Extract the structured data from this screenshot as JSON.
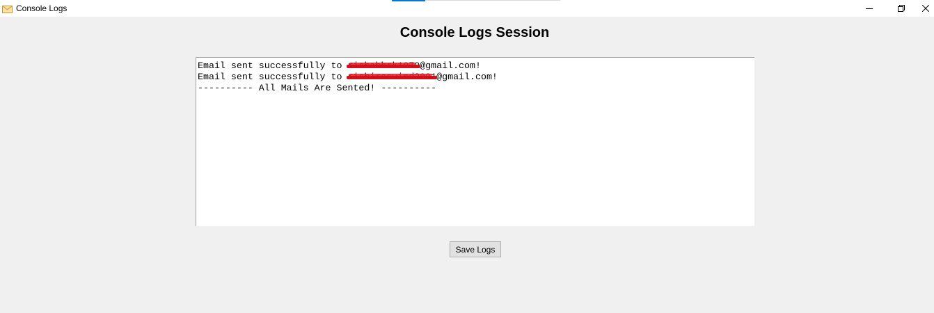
{
  "window": {
    "title": "Console Logs",
    "app_icon": "envelope-icon",
    "controls": {
      "minimize_icon": "minimize-icon",
      "maximize_icon": "restore-icon",
      "close_icon": "close-icon"
    }
  },
  "heading": "Console Logs Session",
  "log": {
    "lines": [
      {
        "prefix": "Email sent successfully to ",
        "redacted": "rishabhrk1070",
        "suffix": "@gmail.com!"
      },
      {
        "prefix": "Email sent successfully to ",
        "redacted": "rishiraswind2001",
        "suffix": "@gmail.com!"
      },
      {
        "text": "---------- All Mails Are Sented! ----------"
      }
    ]
  },
  "buttons": {
    "save_label": "Save Logs"
  },
  "colors": {
    "background": "#f0f0f0",
    "accent": "#0078d7",
    "redaction": "#d0101a"
  }
}
